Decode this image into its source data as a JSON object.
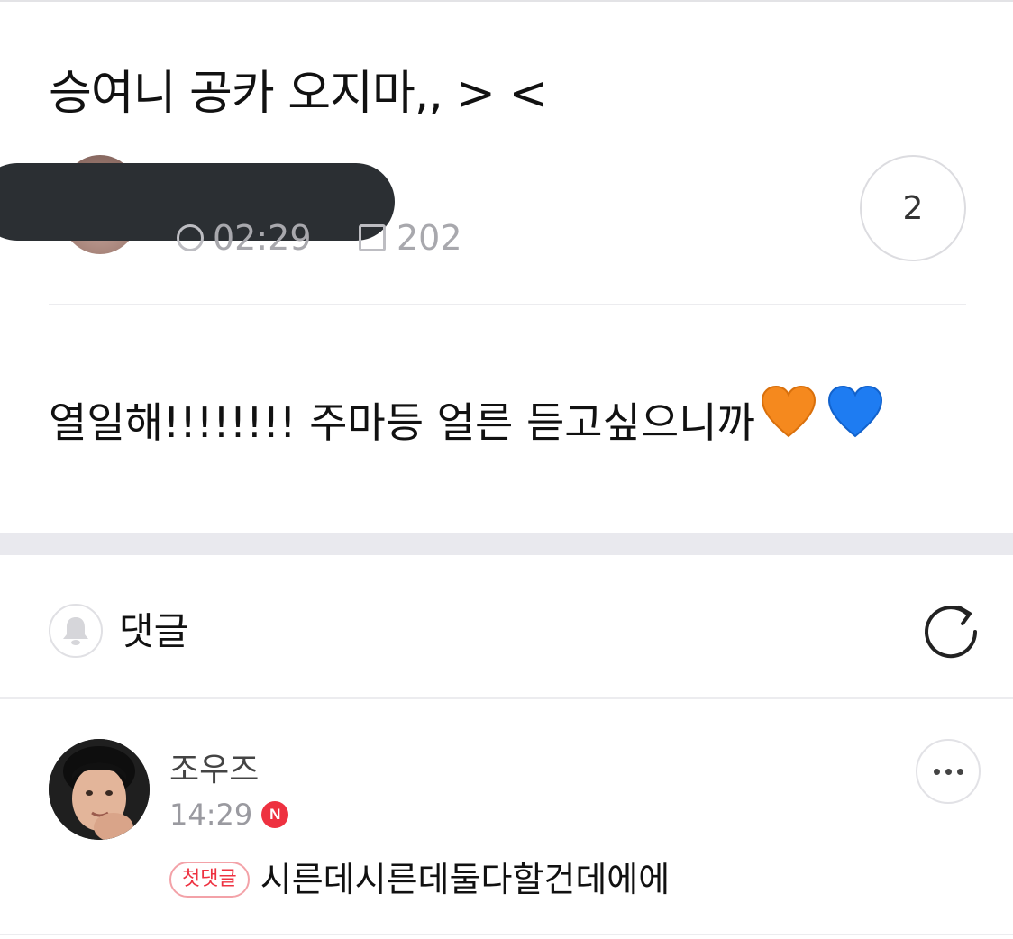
{
  "post": {
    "title": "승여니 공카 오지마,, > <",
    "time": "02:29",
    "views": "202",
    "comment_count": "2",
    "body": "열일해!!!!!!!! 주마등 얼른 듣고싶으니까",
    "body_emojis": {
      "first": {
        "icon": "orange-heart",
        "color": "#F5891E"
      },
      "second": {
        "icon": "blue-heart",
        "color": "#1E7CF2"
      }
    }
  },
  "comments_section": {
    "title": "댓글"
  },
  "comments": [
    {
      "author": "조우즈",
      "time": "14:29",
      "new_badge": "N",
      "first_badge": "첫댓글",
      "text": "시른데시른데둘다할건데에에"
    }
  ],
  "colors": {
    "accent": "#EE3140",
    "redaction": "#2B2F33",
    "section_gap": "#E9E9EE"
  }
}
